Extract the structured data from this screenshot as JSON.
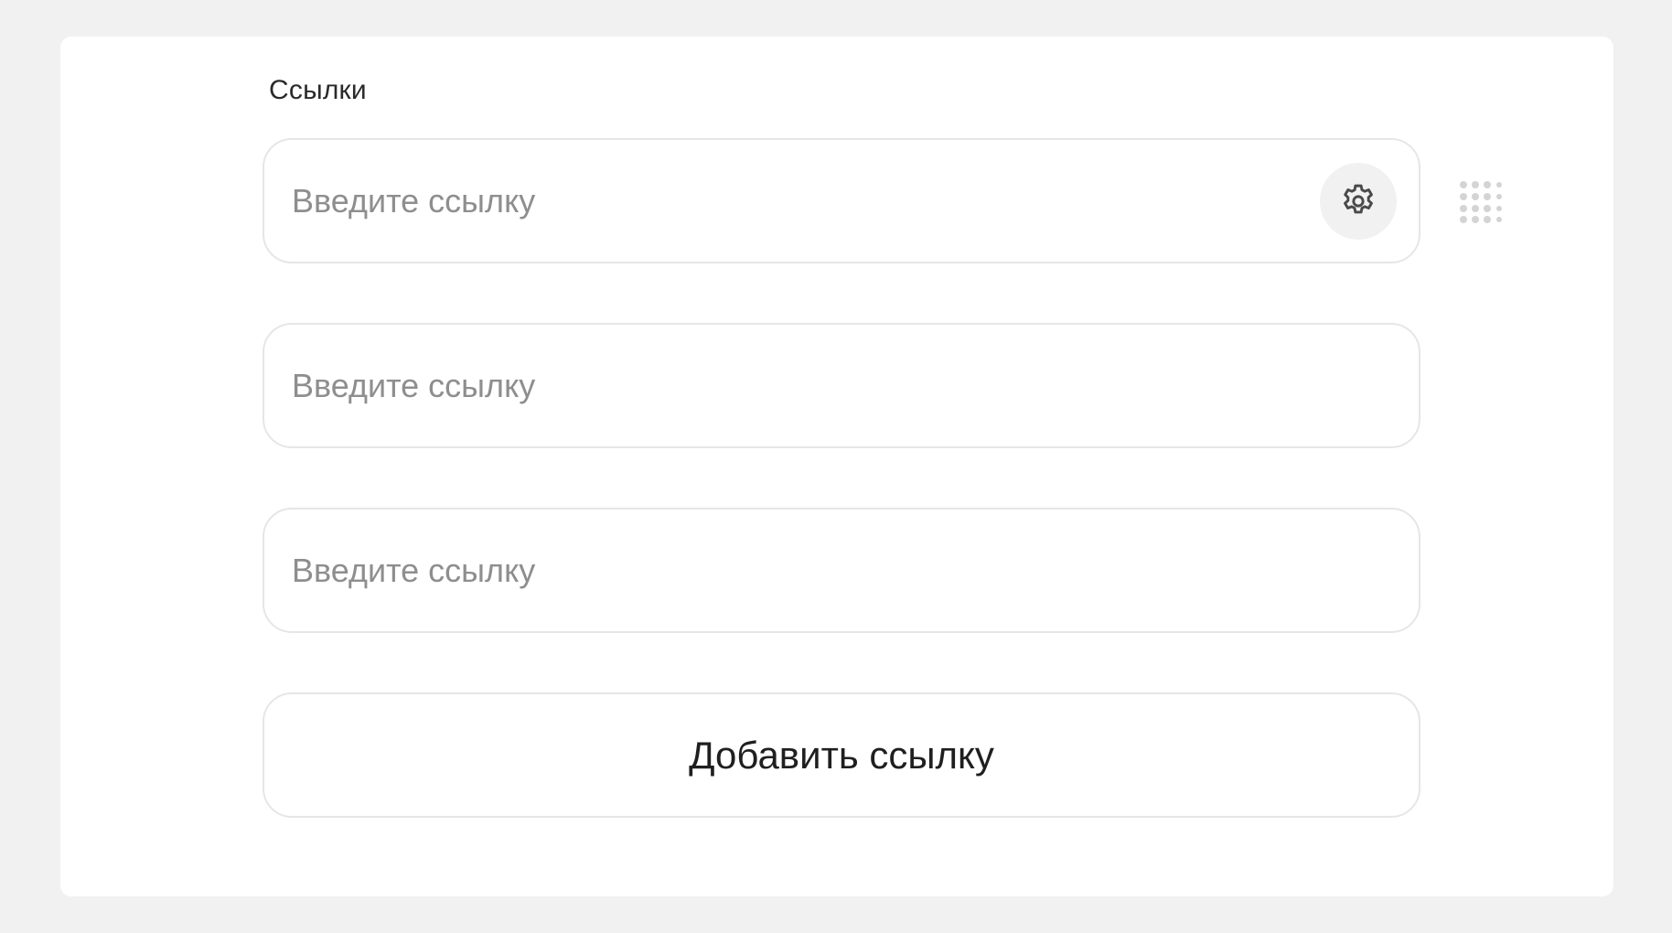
{
  "links_section": {
    "label": "Ссылки",
    "fields": [
      {
        "placeholder": "Введите ссылку",
        "value": ""
      },
      {
        "placeholder": "Введите ссылку",
        "value": ""
      },
      {
        "placeholder": "Введите ссылку",
        "value": ""
      }
    ],
    "settings_icon": "gear-icon",
    "drag_icon": "drag-handle-icon",
    "add_button_label": "Добавить ссылку"
  },
  "colors": {
    "page_background": "#f1f1f1",
    "card_background": "#ffffff",
    "border": "#e6e6e6",
    "placeholder": "#8e8e8e",
    "text": "#1f1f1f",
    "icon": "#4a4a4a",
    "drag_dots": "#d4d4d4"
  }
}
